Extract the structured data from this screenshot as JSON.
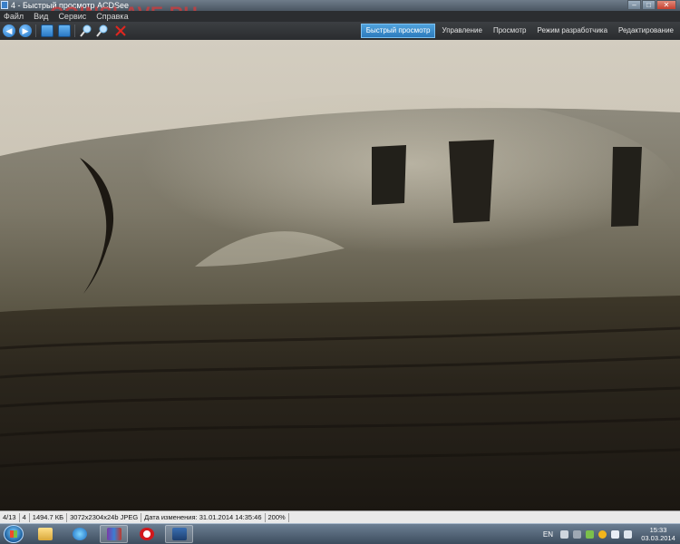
{
  "window": {
    "title": "4 - Быстрый просмотр ACDSee",
    "watermark": "COINSLAVE.RU",
    "buttons": [
      "–",
      "□",
      "✕"
    ]
  },
  "menu": [
    "Файл",
    "Вид",
    "Сервис",
    "Справка"
  ],
  "toolbar": {
    "icons": [
      "back-icon",
      "forward-icon",
      "export-icon",
      "copy-icon",
      "zoom-in-icon",
      "zoom-out-icon",
      "delete-icon"
    ]
  },
  "modes": {
    "active": "Быстрый просмотр",
    "tabs": [
      "Быстрый просмотр",
      "Управление",
      "Просмотр",
      "Режим разработчика",
      "Редактирование"
    ]
  },
  "status": {
    "index": "4/13",
    "page": "4",
    "size": "1494.7 КБ",
    "dims": "3072x2304x24b JPEG",
    "modified": "Дата изменения: 31.01.2014 14:35:46",
    "zoom": "200%"
  },
  "taskbar": {
    "items": [
      "explorer-icon",
      "internet-explorer-icon",
      "winrar-icon",
      "opera-icon",
      "acdsee-icon"
    ],
    "lang": "EN",
    "time": "15:33",
    "date": "03.03.2014"
  },
  "colors": {
    "toolbar_bg": "#2b2d30",
    "active_tab": "#3a8fd0",
    "watermark": "#d63a3a"
  }
}
